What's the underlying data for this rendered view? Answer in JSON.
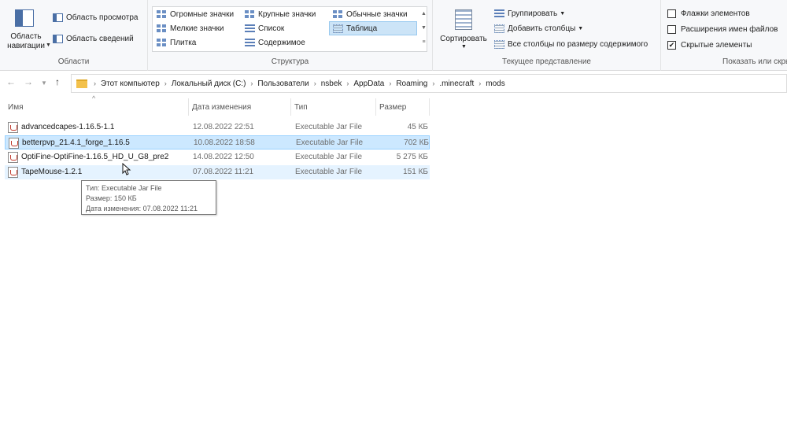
{
  "ribbon": {
    "panes": {
      "label": "Области",
      "nav_pane": "Область\nнавигации",
      "preview_pane": "Область просмотра",
      "details_pane": "Область сведений"
    },
    "layout": {
      "label": "Структура",
      "extra_large": "Огромные значки",
      "large": "Крупные значки",
      "medium": "Обычные значки",
      "small": "Мелкие значки",
      "list": "Список",
      "details": "Таблица",
      "tiles": "Плитка",
      "content": "Содержимое"
    },
    "current_view": {
      "label": "Текущее представление",
      "sort": "Сортировать",
      "group_by": "Группировать",
      "add_columns": "Добавить столбцы",
      "fit_columns": "Все столбцы по размеру содержимого"
    },
    "show_hide": {
      "label": "Показать или скрыть",
      "item_checkboxes": "Флажки элементов",
      "item_checkboxes_checked": false,
      "file_extensions": "Расширения имен файлов",
      "file_extensions_checked": false,
      "hidden_items": "Скрытые элементы",
      "hidden_items_checked": true
    }
  },
  "address": {
    "crumbs": [
      "Этот компьютер",
      "Локальный диск (C:)",
      "Пользователи",
      "nsbek",
      "AppData",
      "Roaming",
      ".minecraft",
      "mods"
    ]
  },
  "columns": {
    "name": "Имя",
    "date": "Дата изменения",
    "type": "Тип",
    "size": "Размер"
  },
  "files": [
    {
      "name": "advancedcapes-1.16.5-1.1",
      "date": "12.08.2022 22:51",
      "type": "Executable Jar File",
      "size": "45 КБ",
      "state": "normal"
    },
    {
      "name": "betterpvp_21.4.1_forge_1.16.5",
      "date": "10.08.2022 18:58",
      "type": "Executable Jar File",
      "size": "702 КБ",
      "state": "selected"
    },
    {
      "name": "OptiFine-OptiFine-1.16.5_HD_U_G8_pre2",
      "date": "14.08.2022 12:50",
      "type": "Executable Jar File",
      "size": "5 275 КБ",
      "state": "normal"
    },
    {
      "name": "TapeMouse-1.2.1",
      "date": "07.08.2022 11:21",
      "type": "Executable Jar File",
      "size": "151 КБ",
      "state": "hover"
    }
  ],
  "tooltip": {
    "type": "Тип: Executable Jar File",
    "size": "Размер: 150 КБ",
    "date": "Дата изменения: 07.08.2022 11:21"
  }
}
